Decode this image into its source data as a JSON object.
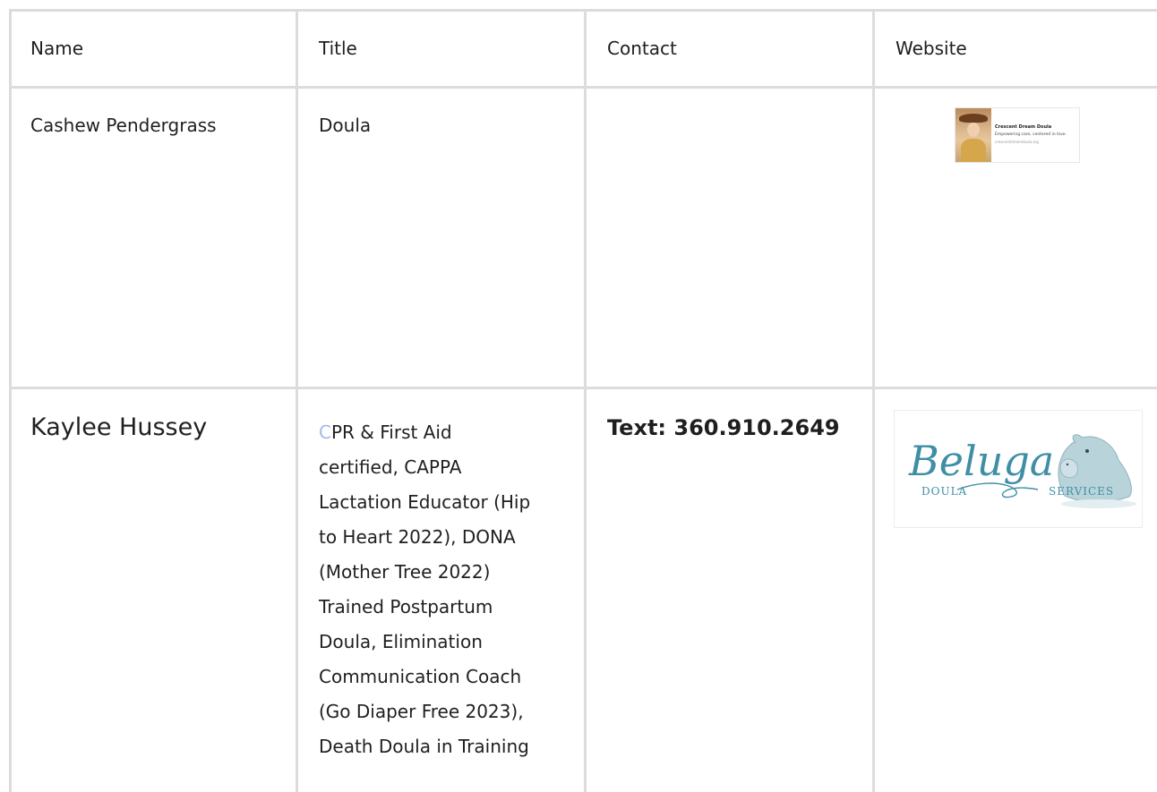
{
  "table": {
    "headers": {
      "name": "Name",
      "title": "Title",
      "contact": "Contact",
      "website": "Website"
    },
    "rows": [
      {
        "name": "Cashew Pendergrass",
        "title": "Doula",
        "contact": "",
        "website_preview": {
          "title": "Crescent Dream Doula",
          "subtitle": "Empowering care, centered in love.",
          "url": "crescentdreamdoula.org"
        }
      },
      {
        "name": "Kaylee Hussey",
        "title_first_char": "C",
        "title_lines": [
          "PR & First Aid",
          "certified, CAPPA",
          "Lactation Educator (Hip",
          "to Heart 2022), DONA",
          "(Mother Tree 2022)",
          "Trained Postpartum",
          "Doula, Elimination",
          "Communication Coach",
          "(Go Diaper Free 2023),",
          "Death Doula in Training"
        ],
        "contact": "Text: 360.910.2649",
        "website_logo": {
          "word": "Beluga",
          "left": "DOULA",
          "right": "SERVICES",
          "color": "#3f8ea6"
        }
      }
    ]
  }
}
